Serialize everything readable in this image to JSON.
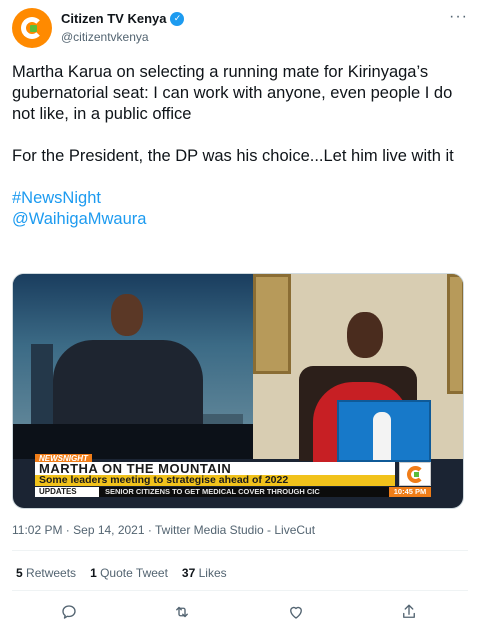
{
  "author": {
    "display_name": "Citizen TV Kenya",
    "handle": "@citizentvkenya",
    "verified_badge": "✓"
  },
  "tweet": {
    "line1": "Martha Karua on selecting a running mate for Kirinyaga’s gubernatorial seat: I can work with anyone, even people I do not like, in a public office",
    "line2": "For the President, the DP was his choice...Let him live with it",
    "hashtag": "#NewsNight",
    "mention": "@WaihigaMwaura"
  },
  "media": {
    "show_tag": "NEWSNIGHT",
    "headline": "MARTHA ON THE MOUNTAIN",
    "subhead": "Some leaders meeting to strategise ahead of 2022",
    "ticker_label": "UPDATES",
    "ticker_text": "SENIOR CITIZENS TO GET MEDICAL COVER THROUGH CIC",
    "ticker_time": "10:45 PM"
  },
  "meta": {
    "timestamp": "11:02 PM · Sep 14, 2021 · Twitter Media Studio - LiveCut"
  },
  "stats": {
    "retweets_count": "5",
    "retweets_label": "Retweets",
    "quotes_count": "1",
    "quotes_label": "Quote Tweet",
    "likes_count": "37",
    "likes_label": "Likes"
  },
  "colors": {
    "accent": "#1d9bf0",
    "brand_orange": "#ff8a00",
    "secondary_text": "#536471"
  },
  "icons": {
    "more": "more-icon",
    "reply": "reply-icon",
    "retweet": "retweet-icon",
    "like": "like-icon",
    "share": "share-icon"
  }
}
